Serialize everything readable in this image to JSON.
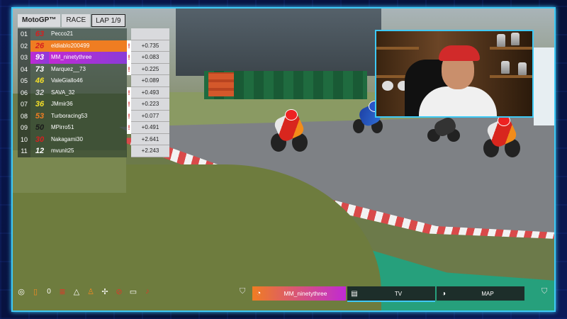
{
  "leaderboard": {
    "series_logo": "MotoGP™",
    "session": "RACE",
    "lap": "LAP 1/9",
    "rows": [
      {
        "pos": "01",
        "num": "63",
        "name": "Pecco21",
        "gap": "",
        "num_color": "#d42020",
        "flag": false,
        "style": "plain"
      },
      {
        "pos": "02",
        "num": "26",
        "name": "eldiablo200499",
        "gap": "+0.735",
        "num_color": "#d42020",
        "flag": true,
        "style": "orange"
      },
      {
        "pos": "03",
        "num": "93",
        "name": "MM_ninetythree",
        "gap": "+0.083",
        "num_color": "#ffffff",
        "flag": true,
        "style": "purple"
      },
      {
        "pos": "04",
        "num": "73",
        "name": "Marquez__73",
        "gap": "+0.225",
        "num_color": "#ffffff",
        "flag": true,
        "style": "plain"
      },
      {
        "pos": "05",
        "num": "46",
        "name": "ValeGiallo46",
        "gap": "+0.089",
        "num_color": "#f5e02a",
        "flag": false,
        "style": "plain"
      },
      {
        "pos": "06",
        "num": "32",
        "name": "SAVA_32",
        "gap": "+0.493",
        "num_color": "#cfcfcf",
        "flag": true,
        "style": "plain"
      },
      {
        "pos": "07",
        "num": "36",
        "name": "JMmir36",
        "gap": "+0.223",
        "num_color": "#f5e02a",
        "flag": true,
        "style": "plain"
      },
      {
        "pos": "08",
        "num": "53",
        "name": "Turboracing53",
        "gap": "+0.077",
        "num_color": "#ef7d22",
        "flag": true,
        "style": "plain"
      },
      {
        "pos": "09",
        "num": "50",
        "name": "MPirro51",
        "gap": "+0.491",
        "num_color": "#1a1a1a",
        "flag": true,
        "style": "plain"
      },
      {
        "pos": "10",
        "num": "30",
        "name": "Nakagami30",
        "gap": "+2.641",
        "num_color": "#d42020",
        "flag": false,
        "style": "plain"
      },
      {
        "pos": "11",
        "num": "12",
        "name": "mvunit25",
        "gap": "+2.243",
        "num_color": "#ffffff",
        "flag": false,
        "style": "plain"
      }
    ]
  },
  "bottom_bar": {
    "counter": "0",
    "icons": [
      "target-icon",
      "door-icon",
      "list-icon",
      "triangle-icon",
      "person-icon",
      "bike-icon",
      "no-eye-icon",
      "keyboard-icon",
      "microphone-icon"
    ],
    "player_name": "MM_ninetythree",
    "tv_label": "TV",
    "map_label": "MAP"
  },
  "colors": {
    "accent": "#3ec9f5",
    "orange": "#ef7d22",
    "purple": "#c02ad4"
  }
}
